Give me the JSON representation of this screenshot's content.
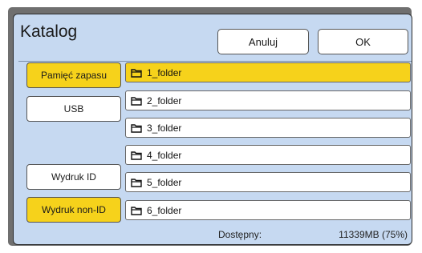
{
  "dialog": {
    "title": "Katalog"
  },
  "buttons": {
    "cancel": "Anuluj",
    "ok": "OK"
  },
  "sidebar": {
    "storage": "Pamięć zapasu",
    "usb": "USB",
    "print_id": "Wydruk ID",
    "print_non_id": "Wydruk non-ID"
  },
  "folders": [
    "1_folder",
    "2_folder",
    "3_folder",
    "4_folder",
    "5_folder",
    "6_folder"
  ],
  "footer": {
    "label": "Dostępny:",
    "value": "11339MB (75%)"
  },
  "colors": {
    "selected": "#f6d21b",
    "panel": "#c6d9f1"
  },
  "icons": {
    "folder": "folder-icon"
  }
}
